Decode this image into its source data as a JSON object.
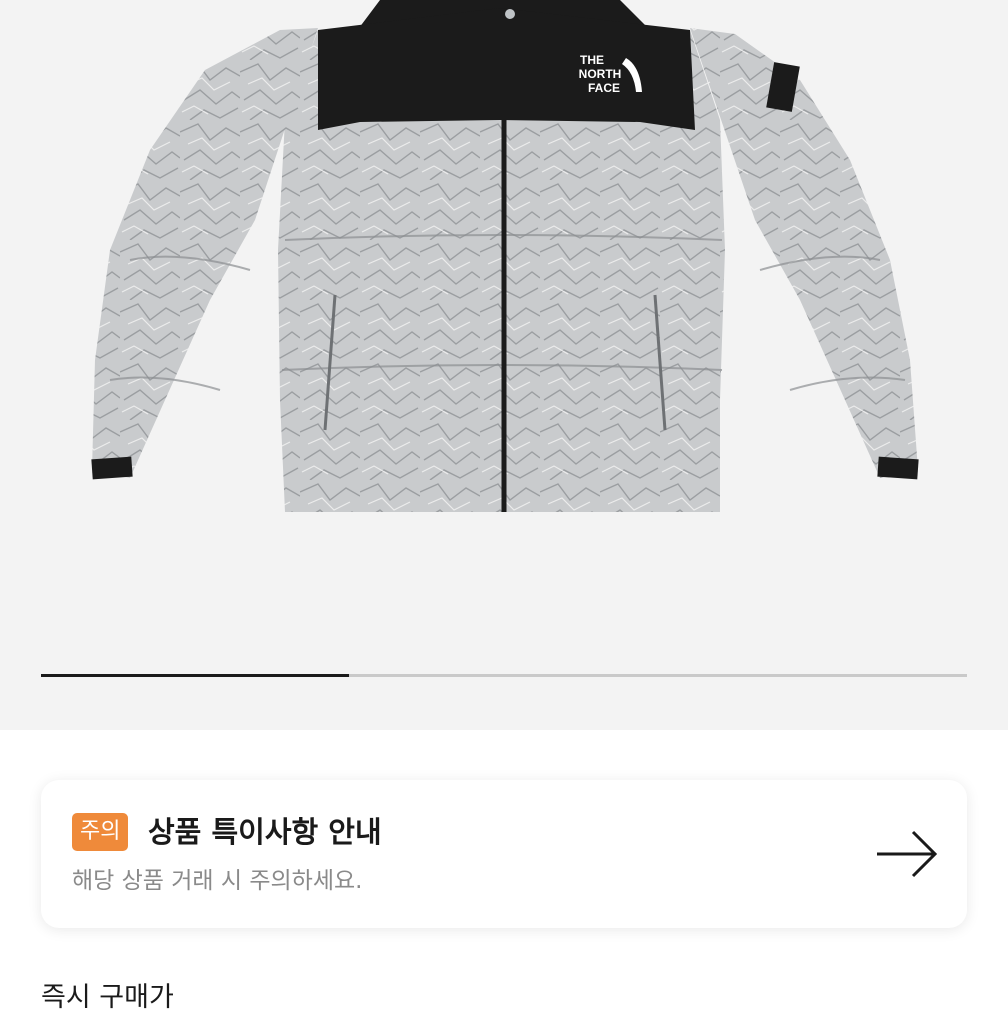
{
  "product": {
    "image_alt": "The North Face paper-print nuptse jacket",
    "brand_logo": [
      "THE",
      "NORTH",
      "FACE"
    ]
  },
  "gallery": {
    "progress_fraction": 0.333
  },
  "notice": {
    "badge": "주의",
    "title": "상품 특이사항 안내",
    "subtitle": "해당 상품 거래 시 주의하세요.",
    "arrow_icon": "arrow-right-icon"
  },
  "price": {
    "label": "즉시 구매가"
  },
  "colors": {
    "accent": "#ef8a3a",
    "jacket_black": "#1b1b1b",
    "jacket_gray": "#c8cacc"
  }
}
